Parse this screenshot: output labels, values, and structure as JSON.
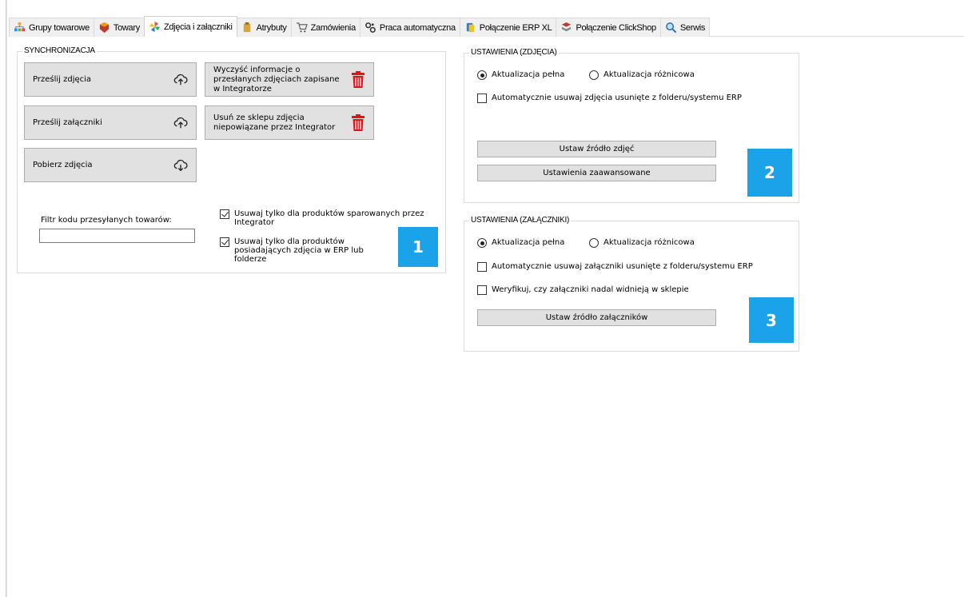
{
  "tabs": [
    {
      "label": "Grupy towarowe",
      "icon": "product-groups-icon"
    },
    {
      "label": "Towary",
      "icon": "products-icon"
    },
    {
      "label": "Zdjęcia i załączniki",
      "icon": "pinwheel-icon",
      "active": true
    },
    {
      "label": "Atrybuty",
      "icon": "attributes-icon"
    },
    {
      "label": "Zamówienia",
      "icon": "cart-icon"
    },
    {
      "label": "Praca automatyczna",
      "icon": "gears-icon"
    },
    {
      "label": "Połączenie ERP XL",
      "icon": "erp-connection-icon"
    },
    {
      "label": "Połączenie ClickShop",
      "icon": "clickshop-connection-icon"
    },
    {
      "label": "Serwis",
      "icon": "magnifier-icon"
    }
  ],
  "sync": {
    "title": "SYNCHRONIZACJA",
    "send_images": "Prześlij zdjęcia",
    "send_attachments": "Prześlij załączniki",
    "download_images": "Pobierz zdjęcia",
    "clear_info": "Wyczyść informacje o przesłanych zdjęciach zapisane w Integratorze",
    "remove_unlinked": "Usuń ze sklepu zdjęcia niepowiązane przez Integrator",
    "filter_label": "Filtr kodu przesyłanych towarów:",
    "filter_value": "",
    "only_paired": {
      "label": "Usuwaj tylko dla produktów sparowanych przez Integrator",
      "checked": true
    },
    "only_with_images": {
      "label": "Usuwaj tylko dla produktów posiadających zdjęcia w ERP lub folderze",
      "checked": true
    },
    "badge": "1"
  },
  "images_settings": {
    "title": "USTAWIENIA (ZDJĘCIA)",
    "radio_full": {
      "label": "Aktualizacja pełna",
      "checked": true
    },
    "radio_diff": {
      "label": "Aktualizacja różnicowa",
      "checked": false
    },
    "auto_delete": {
      "label": "Automatycznie usuwaj zdjęcia usunięte z folderu/systemu ERP",
      "checked": false
    },
    "set_source": "Ustaw źródło zdjęć",
    "advanced": "Ustawienia zaawansowane",
    "badge": "2"
  },
  "attachments_settings": {
    "title": "USTAWIENIA (ZAŁĄCZNIKI)",
    "radio_full": {
      "label": "Aktualizacja pełna",
      "checked": true
    },
    "radio_diff": {
      "label": "Aktualizacja różnicowa",
      "checked": false
    },
    "auto_delete": {
      "label": "Automatycznie usuwaj załączniki usunięte z folderu/systemu ERP",
      "checked": false
    },
    "verify": {
      "label": "Weryfikuj, czy załączniki nadal widnieją w sklepie",
      "checked": false
    },
    "set_source": "Ustaw źródło załączników",
    "badge": "3"
  },
  "colors": {
    "badge": "#1aa3e8",
    "trash": "#e0141e",
    "button_bg": "#e1e1e1"
  }
}
